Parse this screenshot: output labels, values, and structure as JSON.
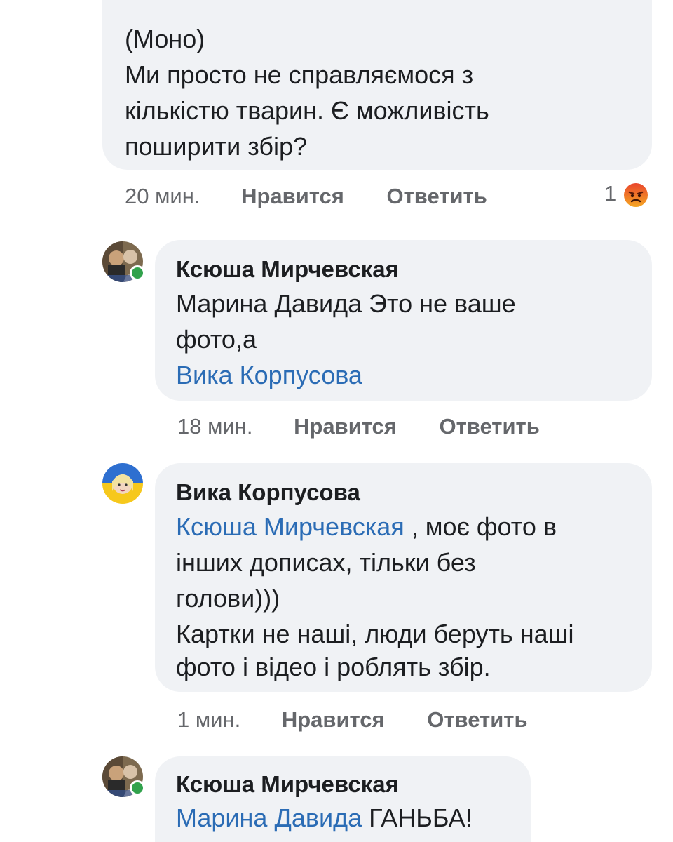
{
  "comment0": {
    "line_cut": "4441111130195153",
    "lines": [
      "(Моно)",
      "Ми просто не справляємося з",
      "кількістю тварин. Є можливість",
      "поширити збір?"
    ],
    "time": "20 мин.",
    "like": "Нравится",
    "reply": "Ответить",
    "reaction_count": "1",
    "reaction_icon": "angry-face-icon"
  },
  "comment1": {
    "author": "Ксюша Мирчевская",
    "text_line1": "Марина Давида  Это не ваше",
    "text_line2": "фото,а",
    "mention": "Вика Корпусова",
    "time": "18 мин.",
    "like": "Нравится",
    "reply": "Ответить"
  },
  "comment2": {
    "author": "Вика Корпусова",
    "mention": "Ксюша Мирчевская",
    "after_mention": " , моє фото в",
    "lines": [
      "інших дописах, тільки без",
      "голови)))",
      "Картки не наші, люди беруть наші",
      "фото і відео і роблять збір."
    ],
    "time": "1 мин.",
    "like": "Нравится",
    "reply": "Ответить"
  },
  "comment3": {
    "author": "Ксюша Мирчевская",
    "mention": "Марина Давида",
    "text": " ГАНЬБА!"
  },
  "colors": {
    "bubble": "#f0f2f5",
    "mention": "#2b6cb5",
    "meta": "#65676b",
    "online": "#31a24c"
  }
}
